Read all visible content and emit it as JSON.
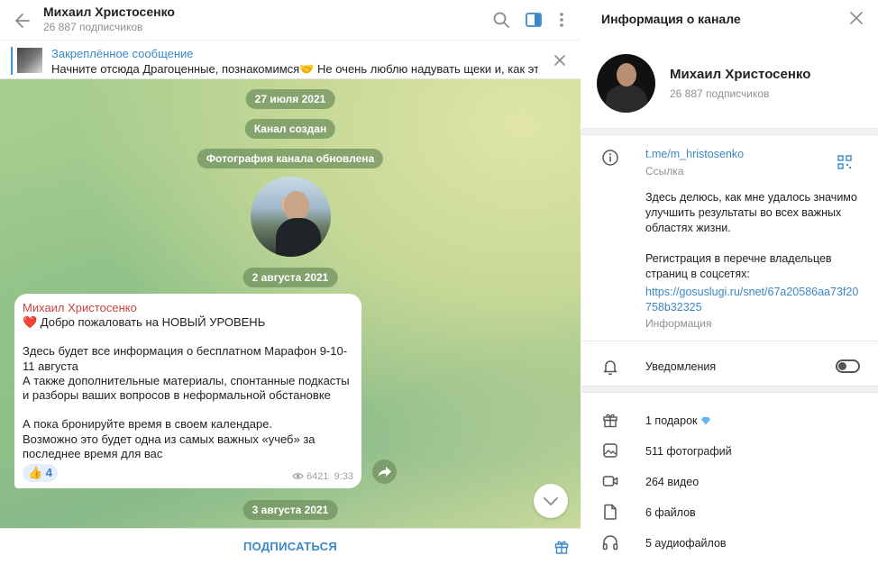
{
  "chat": {
    "title": "Михаил Христосенко",
    "subtitle": "26 887 подписчиков",
    "pinned": {
      "title": "Закреплённое сообщение",
      "text": "Начните отсюда  Драгоценные, познакомимся🤝 Не очень люблю надувать щеки и, как это ..."
    },
    "service_messages": {
      "date1": "27 июля 2021",
      "created": "Канал создан",
      "photo_updated": "Фотография канала обновлена",
      "date2": "2 августа 2021",
      "date3": "3 августа 2021"
    },
    "message": {
      "author": "Михаил Христосенко",
      "heart": "❤️",
      "text": " Добро пожаловать на НОВЫЙ УРОВЕНЬ\n\nЗдесь будет все информация о бесплатном Марафон 9-10-11 августа\nА также дополнительные материалы, спонтанные подкасты и разборы ваших вопросов в неформальной обстановке\n\nА пока бронируйте время в своем календаре.\nВозможно это будет одна из самых важных «учеб» за последнее время для вас",
      "reaction": "👍 4",
      "views": "6421",
      "time": "9:33"
    },
    "subscribe_label": "ПОДПИСАТЬСЯ"
  },
  "info": {
    "title": "Информация о канале",
    "name": "Михаил Христосенко",
    "subtitle": "26 887 подписчиков",
    "link": "t.me/m_hristosenko",
    "link_label": "Ссылка",
    "description": "Здесь делюсь, как мне удалось значимо улучшить результаты во всех важных областях жизни.\n\nРегистрация в перечне владельцев страниц в соцсетях:",
    "gosuslugi_link": "https://gosuslugi.ru/snet/67a20586aa73f20758b32325",
    "info_label": "Информация",
    "notifications_label": "Уведомления",
    "notifications_on": false,
    "media": {
      "gifts": "1 подарок",
      "photos": "511 фотографий",
      "videos": "264 видео",
      "files": "6 файлов",
      "audio": "5 аудиофайлов"
    }
  },
  "colors": {
    "accent": "#3a88c8",
    "author": "#c9443e",
    "pill": "#709260"
  }
}
